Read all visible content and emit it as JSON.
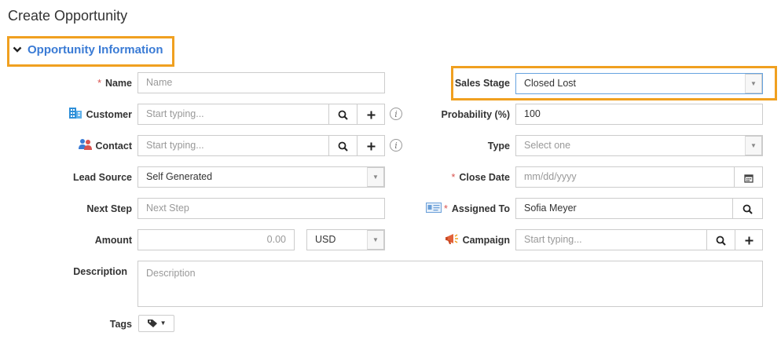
{
  "page": {
    "title": "Create Opportunity"
  },
  "section": {
    "title": "Opportunity Information"
  },
  "left": {
    "name": {
      "label": "Name",
      "placeholder": "Name"
    },
    "customer": {
      "label": "Customer",
      "placeholder": "Start typing..."
    },
    "contact": {
      "label": "Contact",
      "placeholder": "Start typing..."
    },
    "lead_source": {
      "label": "Lead Source",
      "value": "Self Generated"
    },
    "next_step": {
      "label": "Next Step",
      "placeholder": "Next Step"
    },
    "amount": {
      "label": "Amount",
      "value": "0.00",
      "currency": "USD"
    },
    "description": {
      "label": "Description",
      "placeholder": "Description"
    },
    "tags": {
      "label": "Tags"
    }
  },
  "right": {
    "sales_stage": {
      "label": "Sales Stage",
      "value": "Closed Lost"
    },
    "probability": {
      "label": "Probability (%)",
      "value": "100"
    },
    "type": {
      "label": "Type",
      "placeholder": "Select one"
    },
    "close_date": {
      "label": "Close Date",
      "placeholder": "mm/dd/yyyy"
    },
    "assigned_to": {
      "label": "Assigned To",
      "value": "Sofia Meyer"
    },
    "campaign": {
      "label": "Campaign",
      "placeholder": "Start typing..."
    }
  },
  "required_marker": "*",
  "icons": {
    "customer": "building-icon",
    "contact": "people-icon",
    "assigned_to": "id-card-icon",
    "campaign": "megaphone-icon",
    "search": "search-icon",
    "add": "plus-icon",
    "info": "info-icon",
    "calendar": "calendar-icon",
    "tag": "tag-icon",
    "caret": "caret-down-icon"
  },
  "colors": {
    "highlight": "#f0a020",
    "section_title": "#3a7bd5",
    "required": "#d9534f"
  }
}
